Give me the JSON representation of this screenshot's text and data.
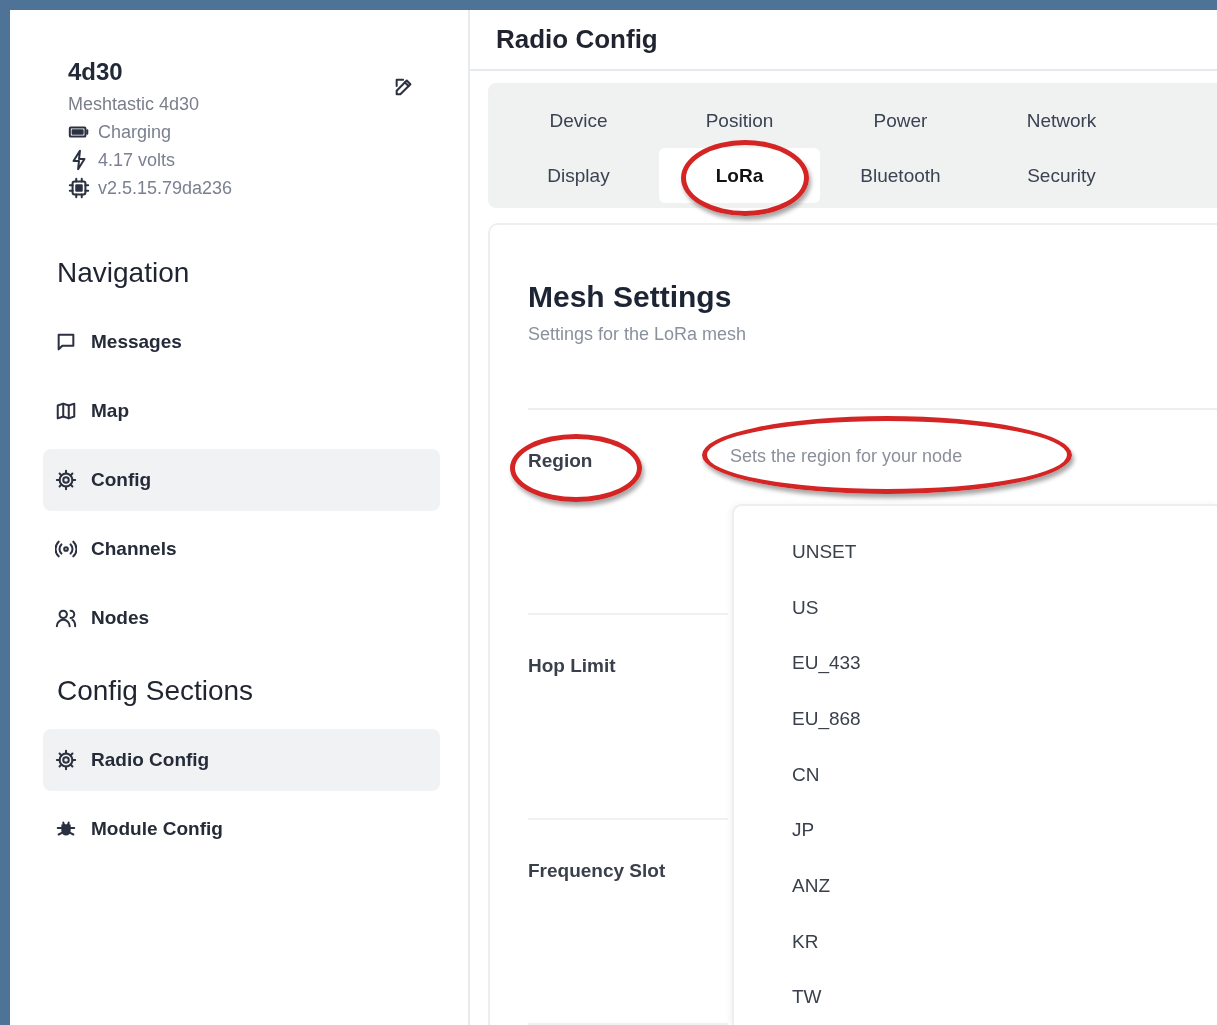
{
  "device": {
    "name": "4d30",
    "model": "Meshtastic 4d30",
    "battery": "Charging",
    "voltage": "4.17 volts",
    "firmware": "v2.5.15.79da236"
  },
  "navigation": {
    "heading": "Navigation",
    "items": [
      {
        "label": "Messages",
        "kind": "messages",
        "selected": false
      },
      {
        "label": "Map",
        "kind": "map",
        "selected": false
      },
      {
        "label": "Config",
        "kind": "config",
        "selected": true
      },
      {
        "label": "Channels",
        "kind": "channels",
        "selected": false
      },
      {
        "label": "Nodes",
        "kind": "nodes",
        "selected": false
      }
    ]
  },
  "config_sections": {
    "heading": "Config Sections",
    "items": [
      {
        "label": "Radio Config",
        "kind": "config",
        "selected": true
      },
      {
        "label": "Module Config",
        "kind": "module",
        "selected": false
      }
    ]
  },
  "page_title": "Radio Config",
  "tabs": [
    {
      "label": "Device",
      "selected": false,
      "circled": false
    },
    {
      "label": "Position",
      "selected": false,
      "circled": false
    },
    {
      "label": "Power",
      "selected": false,
      "circled": false
    },
    {
      "label": "Network",
      "selected": false,
      "circled": false
    },
    {
      "label": "Display",
      "selected": false,
      "circled": false
    },
    {
      "label": "LoRa",
      "selected": true,
      "circled": true
    },
    {
      "label": "Bluetooth",
      "selected": false,
      "circled": false
    },
    {
      "label": "Security",
      "selected": false,
      "circled": false
    }
  ],
  "section": {
    "title": "Mesh Settings",
    "subtitle": "Settings for the LoRa mesh",
    "fields": [
      {
        "label": "Region",
        "circled": true,
        "placeholder": "Sets the region for your node",
        "placeholder_circled": true
      },
      {
        "label": "Hop Limit",
        "circled": false
      },
      {
        "label": "Frequency Slot",
        "circled": false
      }
    ]
  },
  "dropdown": {
    "options": [
      {
        "label": "UNSET",
        "selected": false
      },
      {
        "label": "US",
        "selected": false
      },
      {
        "label": "EU_433",
        "selected": false
      },
      {
        "label": "EU_868",
        "selected": false
      },
      {
        "label": "CN",
        "selected": false
      },
      {
        "label": "JP",
        "selected": false
      },
      {
        "label": "ANZ",
        "selected": false
      },
      {
        "label": "KR",
        "selected": false
      },
      {
        "label": "TW",
        "selected": false
      }
    ]
  }
}
